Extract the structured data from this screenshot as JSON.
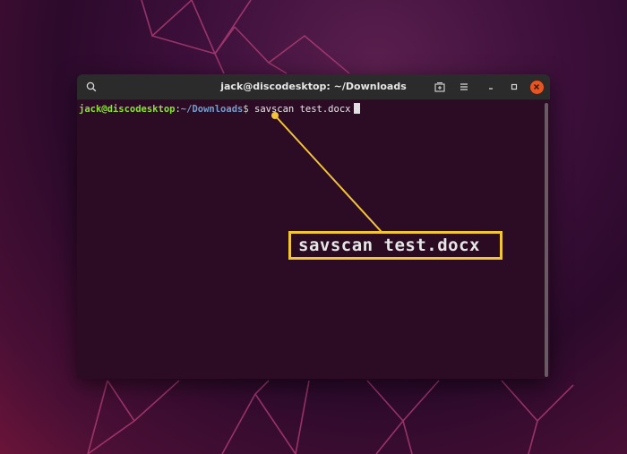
{
  "window": {
    "title": "jack@discodesktop: ~/Downloads"
  },
  "terminal": {
    "prompt_user": "jack@discodesktop",
    "prompt_colon": ":",
    "prompt_path": "~/Downloads",
    "prompt_symbol": "$",
    "command": " savscan test.docx"
  },
  "callout": {
    "text": "savscan test.docx",
    "color": "#f2c43a"
  },
  "colors": {
    "terminal_bg": "#2c0c24",
    "close_button": "#e95420",
    "prompt_user": "#8ae234",
    "prompt_path": "#729fcf"
  },
  "icons": {
    "search": "search-icon",
    "new_tab": "new-tab-icon",
    "menu": "hamburger-menu-icon",
    "minimize": "minimize-icon",
    "maximize": "maximize-icon",
    "close": "close-icon"
  }
}
